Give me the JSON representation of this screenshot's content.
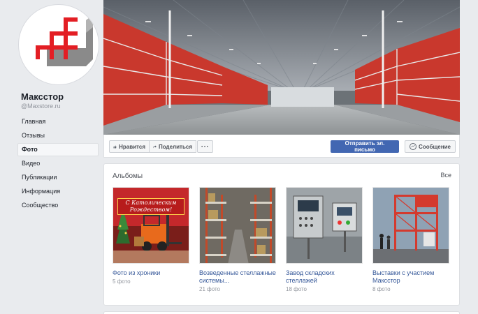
{
  "page": {
    "name": "Максстор",
    "handle": "@Maxstore.ru"
  },
  "nav": {
    "items": [
      {
        "label": "Главная"
      },
      {
        "label": "Отзывы"
      },
      {
        "label": "Фото"
      },
      {
        "label": "Видео"
      },
      {
        "label": "Публикации"
      },
      {
        "label": "Информация"
      },
      {
        "label": "Сообщество"
      }
    ],
    "active": "Фото"
  },
  "actions": {
    "like_label": "Нравится",
    "share_label": "Поделиться",
    "more_label": "···",
    "email_label": "Отправить эл. письмо",
    "message_label": "Сообщение"
  },
  "albums": {
    "title": "Альбомы",
    "see_all": "Все",
    "items": [
      {
        "name": "Фото из хроники",
        "count": "5 фото",
        "banner_text": "С Католическим Рождеством!"
      },
      {
        "name": "Возведенные стеллажные системы...",
        "count": "21 фото"
      },
      {
        "name": "Завод складских стеллажей",
        "count": "18 фото"
      },
      {
        "name": "Выставки с участием Максстор",
        "count": "8 фото"
      }
    ]
  },
  "colors": {
    "primary_blue": "#4267b2",
    "link_blue": "#365899",
    "brand_red": "#e31e24"
  }
}
